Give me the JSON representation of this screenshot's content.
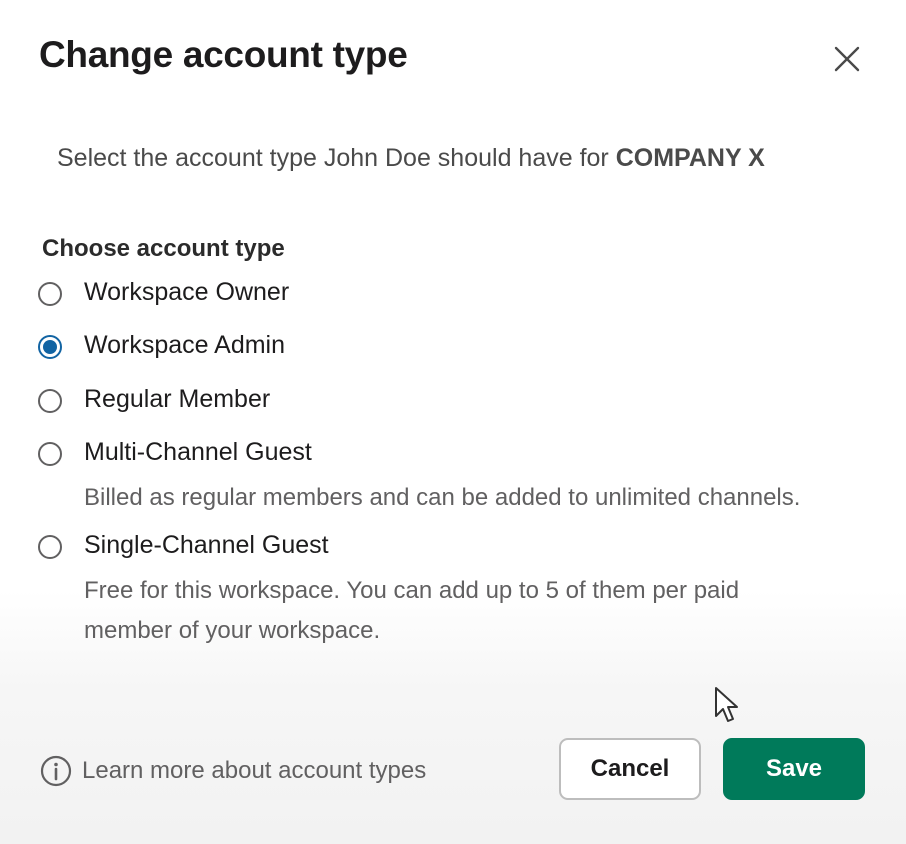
{
  "dialog": {
    "title": "Change account type",
    "subtitle_prefix": "Select the account type John Doe  should have for ",
    "subtitle_company": "COMPANY X",
    "section_label": "Choose account type",
    "options": [
      {
        "label": "Workspace Owner",
        "description": "",
        "selected": false
      },
      {
        "label": "Workspace Admin",
        "description": "",
        "selected": true
      },
      {
        "label": "Regular Member",
        "description": "",
        "selected": false
      },
      {
        "label": "Multi-Channel Guest",
        "description": "Billed as regular members and can be added to unlimited channels.",
        "selected": false
      },
      {
        "label": "Single-Channel Guest",
        "description": "Free for this workspace. You can add up to 5 of them per paid member of your workspace.",
        "selected": false
      }
    ],
    "footer_link": "Learn more about account types",
    "cancel_label": "Cancel",
    "save_label": "Save"
  },
  "icons": {
    "close": "close-icon",
    "info": "info-icon",
    "cursor": "mouse-pointer-icon"
  },
  "colors": {
    "accent": "#1264a3",
    "primary_button": "#007a5a"
  }
}
